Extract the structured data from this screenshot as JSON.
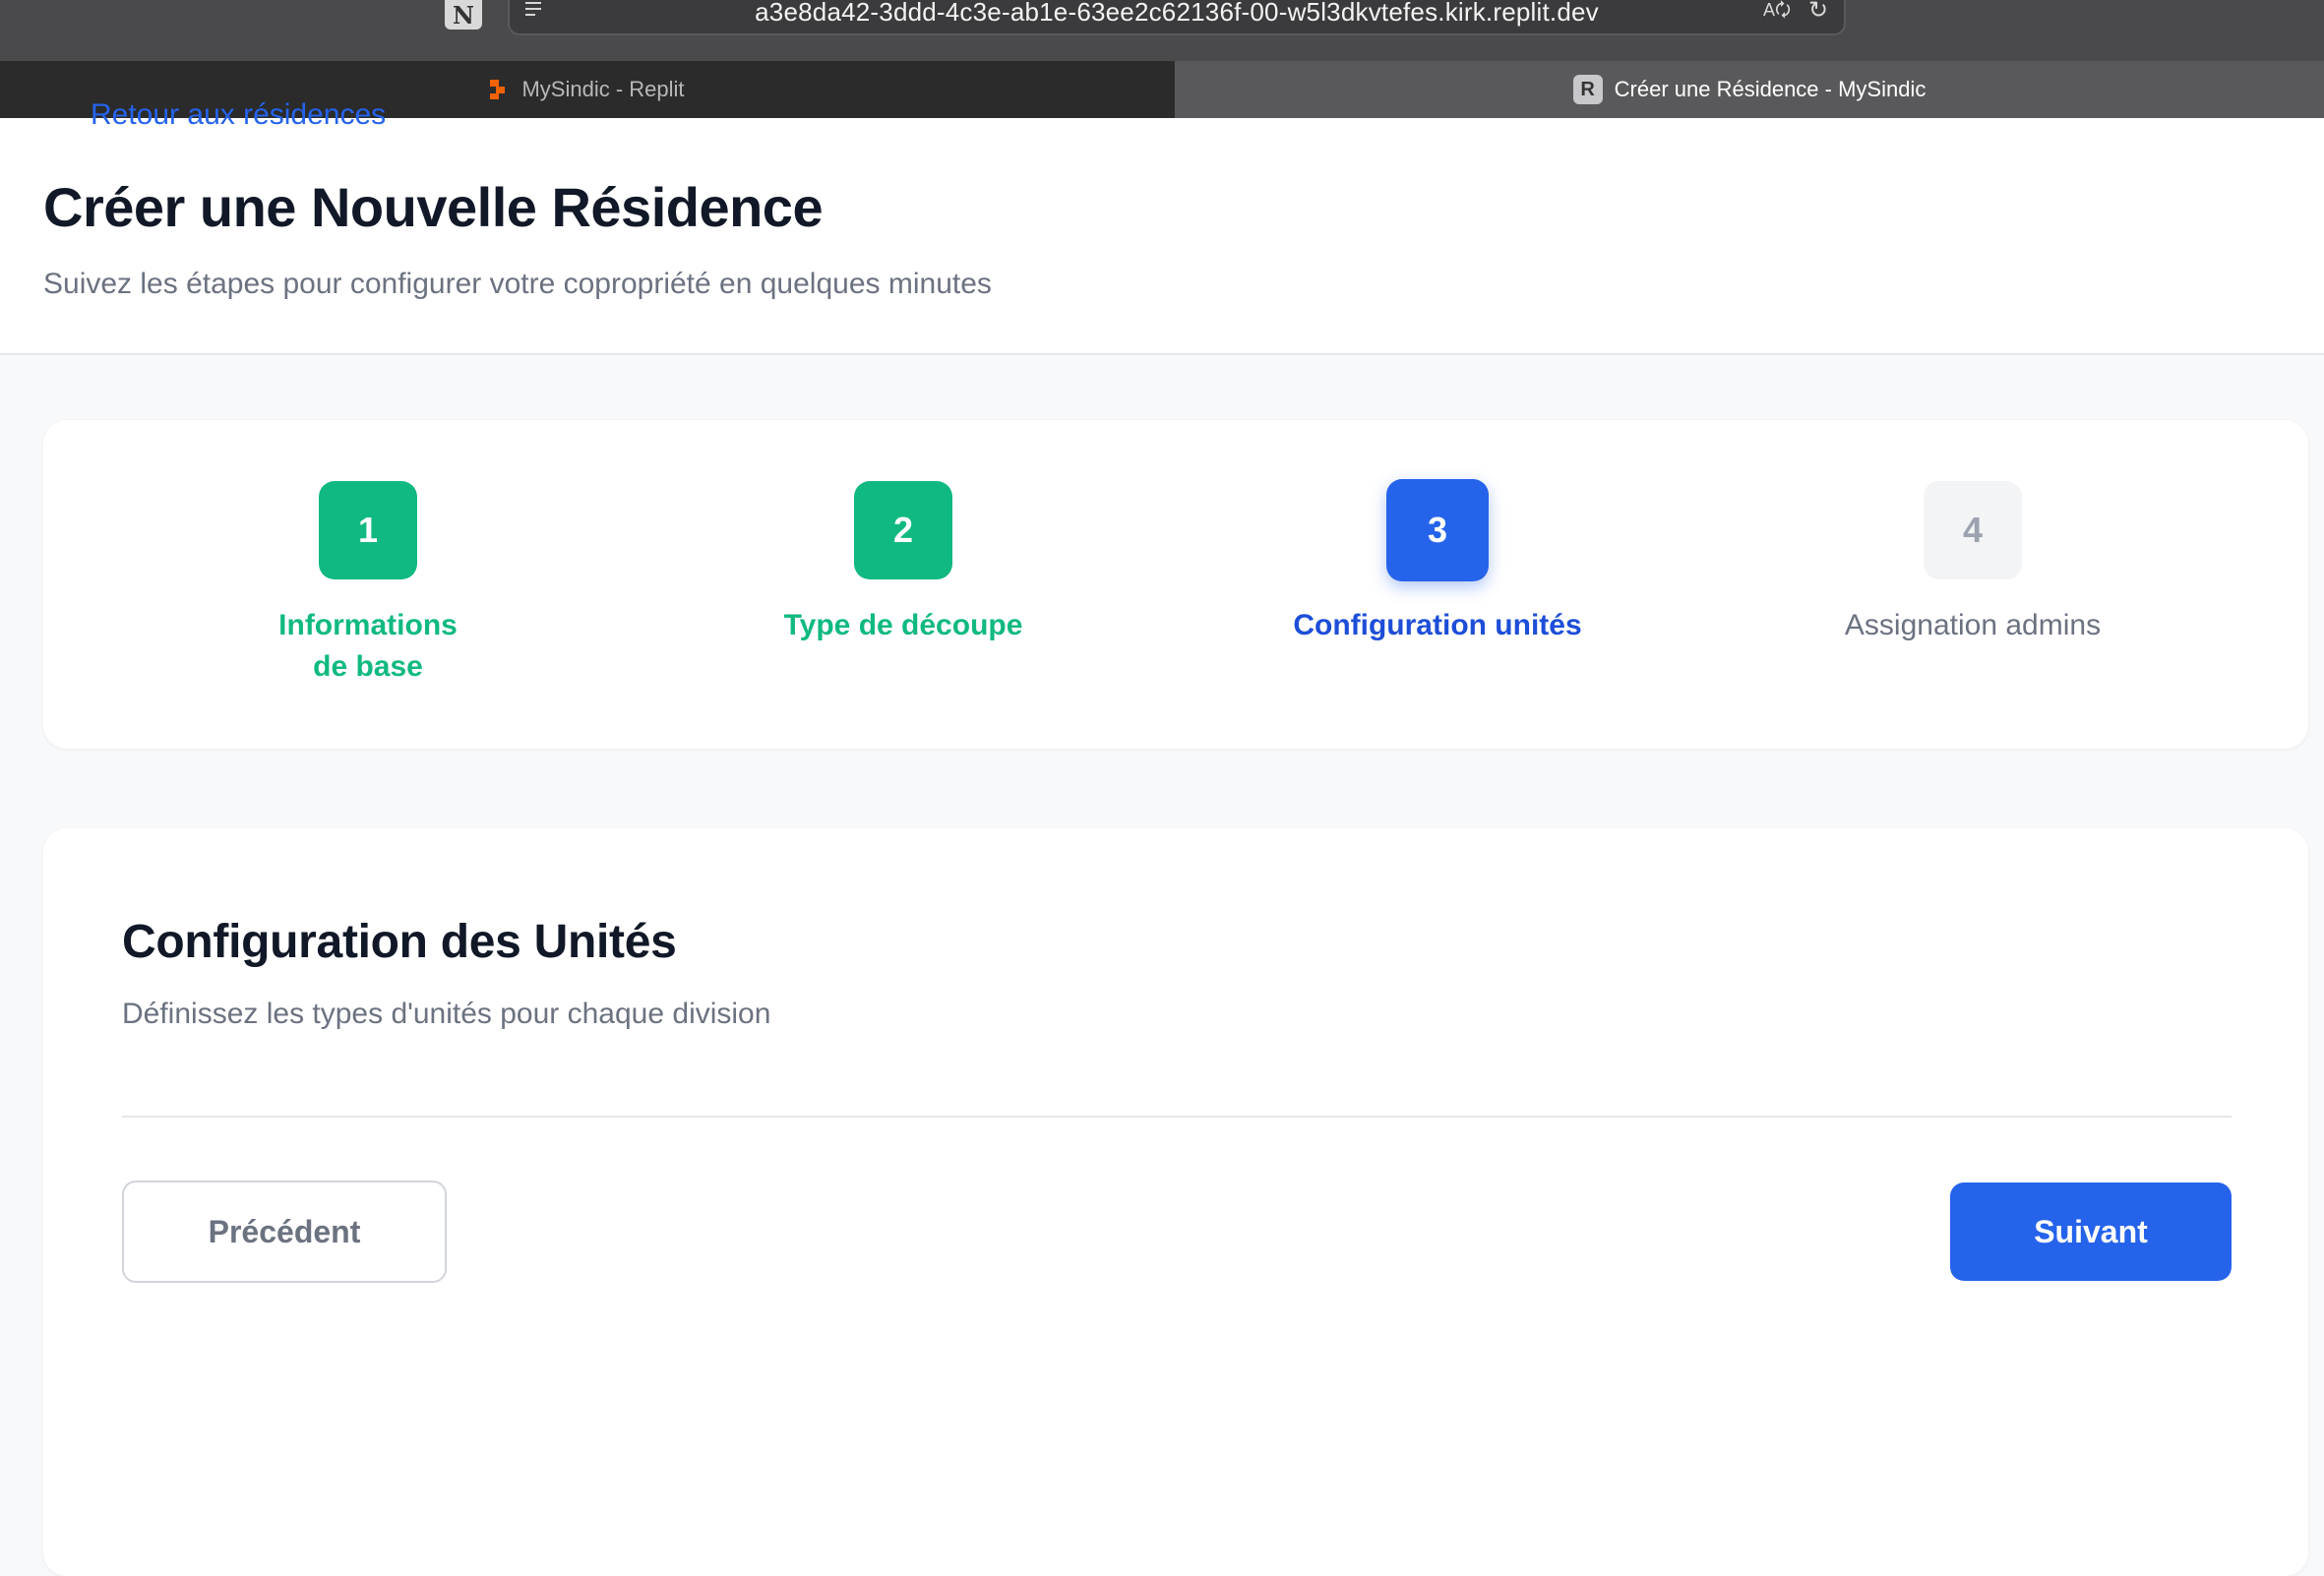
{
  "browser": {
    "url": "a3e8da42-3ddd-4c3e-ab1e-63ee2c62136f-00-w5l3dkvtefes.kirk.replit.dev",
    "tabs": [
      {
        "label": "MySindic - Replit",
        "icon": "replit-icon",
        "active": false
      },
      {
        "label": "Créer une Résidence - MySindic",
        "icon": "r-favicon",
        "favicon_letter": "R",
        "active": true
      }
    ],
    "notion_letter": "N"
  },
  "header": {
    "back_link": "Retour aux résidences",
    "title": "Créer une Nouvelle Résidence",
    "subtitle": "Suivez les étapes pour configurer votre copropriété en quelques minutes"
  },
  "steps": [
    {
      "number": "1",
      "label": "Informations de base",
      "status": "done"
    },
    {
      "number": "2",
      "label": "Type de découpe",
      "status": "done"
    },
    {
      "number": "3",
      "label": "Configuration unités",
      "status": "current"
    },
    {
      "number": "4",
      "label": "Assignation admins",
      "status": "todo"
    }
  ],
  "form": {
    "title": "Configuration des Unités",
    "subtitle": "Définissez les types d'unités pour chaque division",
    "prev_label": "Précédent",
    "next_label": "Suivant"
  },
  "colors": {
    "primary": "#2563eb",
    "success": "#10b981",
    "muted": "#6b7280",
    "heading": "#111827"
  }
}
